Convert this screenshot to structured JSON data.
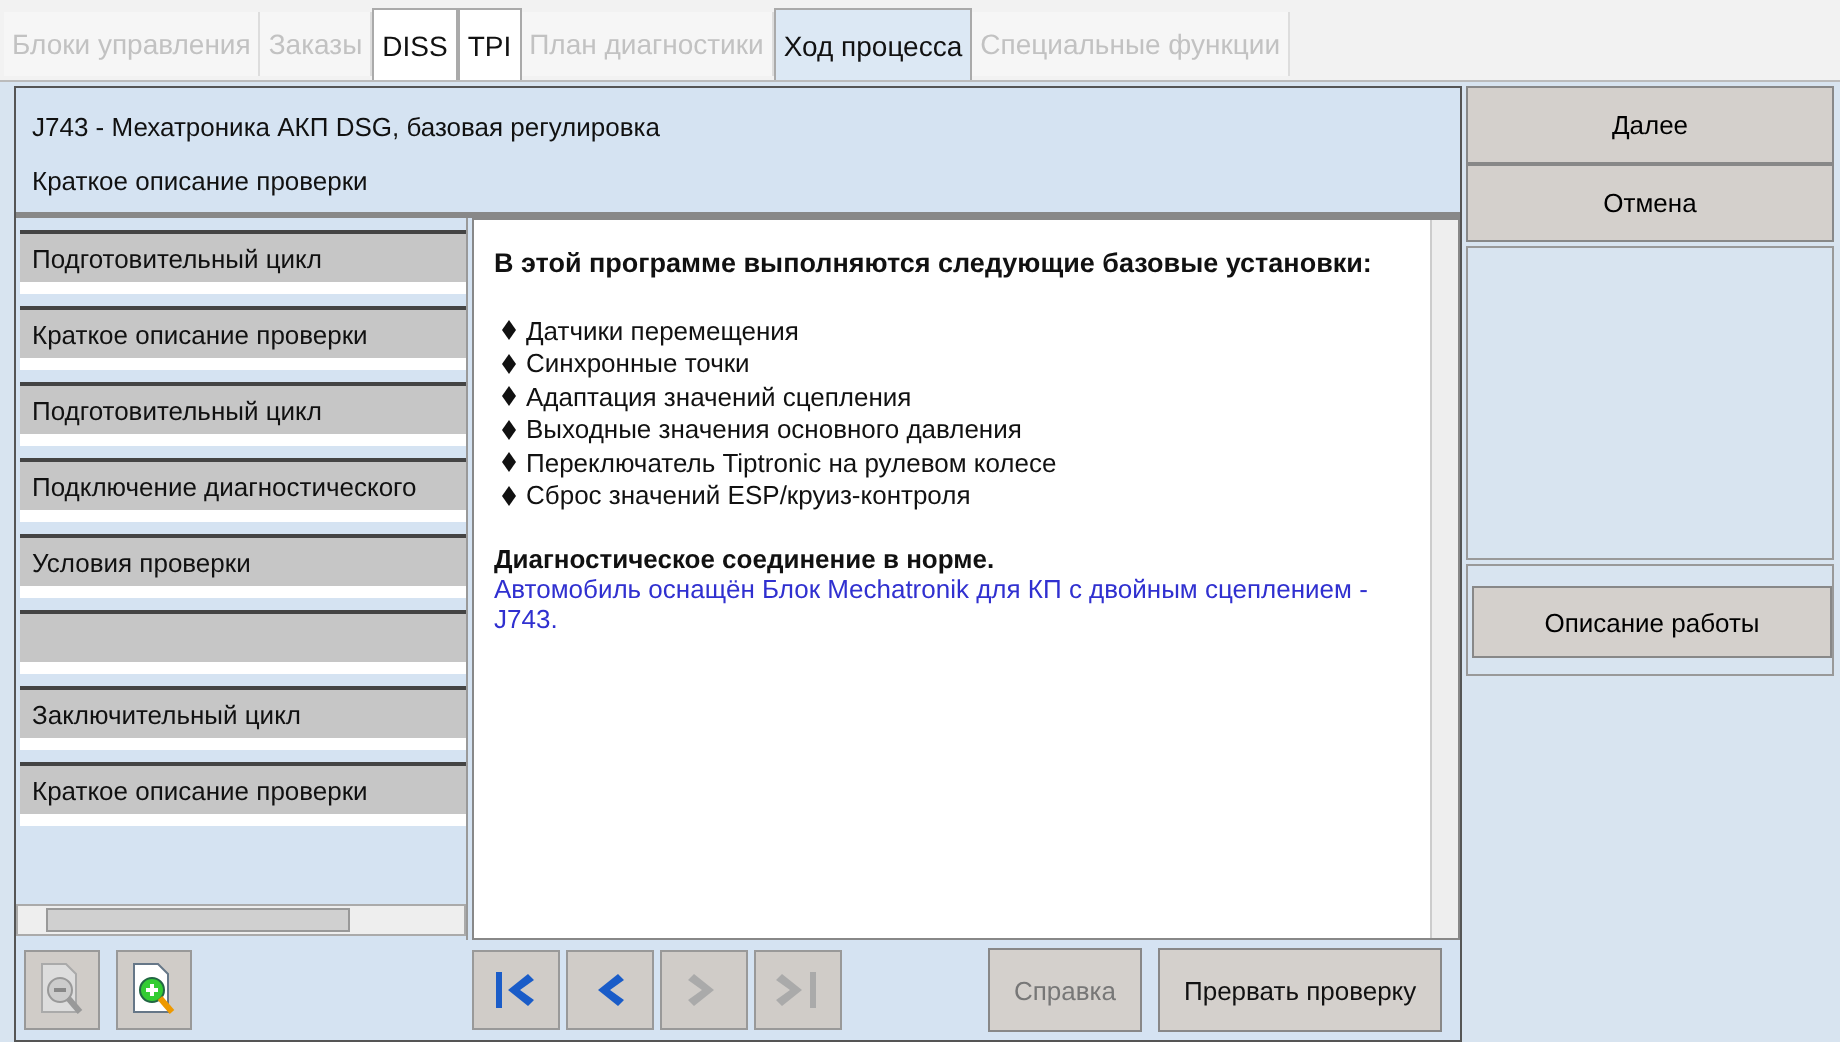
{
  "tabs": [
    {
      "label": "Блоки управления",
      "selected": false,
      "disabled": true
    },
    {
      "label": "Заказы",
      "selected": false,
      "disabled": true
    },
    {
      "label": "DISS",
      "selected": false,
      "disabled": false
    },
    {
      "label": "TPI",
      "selected": false,
      "disabled": false
    },
    {
      "label": "План диагностики",
      "selected": false,
      "disabled": true
    },
    {
      "label": "Ход процесса",
      "selected": true,
      "disabled": false
    },
    {
      "label": "Специальные функции",
      "selected": false,
      "disabled": true
    }
  ],
  "header": {
    "title": "J743 - Мехатроника АКП DSG, базовая регулировка",
    "subtitle": "Краткое описание проверки"
  },
  "steps": [
    {
      "kind": "step",
      "label": "Подготовительный цикл"
    },
    {
      "kind": "step",
      "label": "Краткое описание проверки"
    },
    {
      "kind": "step",
      "label": "Подготовительный цикл"
    },
    {
      "kind": "step",
      "label": "Подключение диагностического"
    },
    {
      "kind": "step",
      "label": "Условия проверки"
    },
    {
      "kind": "blank"
    },
    {
      "kind": "step",
      "label": "Заключительный цикл"
    },
    {
      "kind": "step",
      "label": "Краткое описание проверки"
    }
  ],
  "content": {
    "heading": "В этой программе выполняются следующие базовые установки:",
    "items": [
      "Датчики перемещения",
      "Синхронные точки",
      "Адаптация значений сцепления",
      "Выходные значения основного давления",
      "Переключатель Tiptronic на рулевом колесе",
      "Сброс значений ESP/круиз-контроля"
    ],
    "status": "Диагностическое соединение в норме.",
    "note": "Автомобиль оснащён Блок Mechatronik для КП с двойным сцеплением - J743."
  },
  "zoom_buttons": [
    {
      "kind": "zoom-out",
      "disabled": true
    },
    {
      "kind": "zoom-in",
      "disabled": false
    }
  ],
  "nav_buttons": [
    {
      "kind": "first",
      "disabled": false
    },
    {
      "kind": "prev",
      "disabled": false
    },
    {
      "kind": "next",
      "disabled": true
    },
    {
      "kind": "last",
      "disabled": true
    }
  ],
  "bottom_buttons": [
    {
      "label": "Справка",
      "disabled": true
    },
    {
      "label": "Прервать проверку",
      "disabled": false
    }
  ],
  "side_buttons": [
    {
      "label": "Далее"
    },
    {
      "label": "Отмена"
    }
  ],
  "side_action": {
    "label": "Описание работы"
  }
}
